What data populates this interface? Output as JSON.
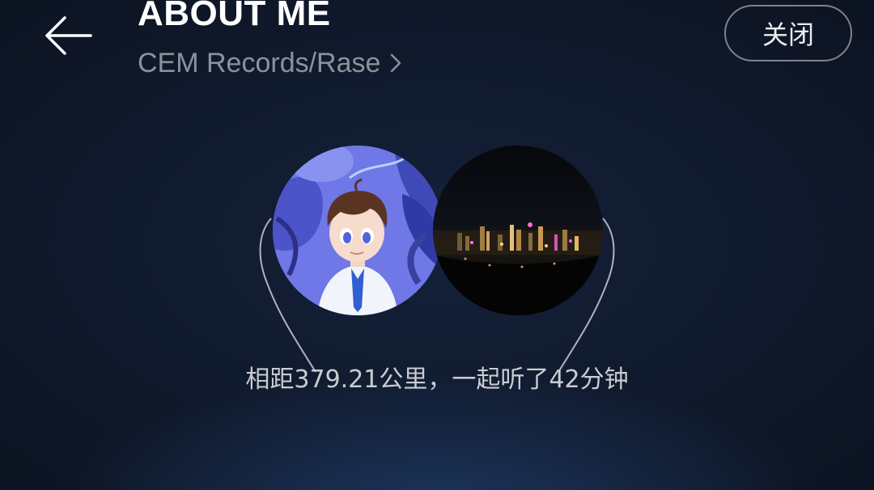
{
  "header": {
    "title": "ABOUT ME",
    "subtitle": "CEM Records/Rase",
    "close_label": "关闭",
    "back_icon": "arrow-left-icon",
    "subtitle_icon": "chevron-right-icon"
  },
  "listen_together": {
    "status_text": "相距379.21公里，一起听了42分钟"
  },
  "colors": {
    "background": "#0f1726",
    "subtitle": "#8b929c",
    "close_border": "#7d848e"
  }
}
